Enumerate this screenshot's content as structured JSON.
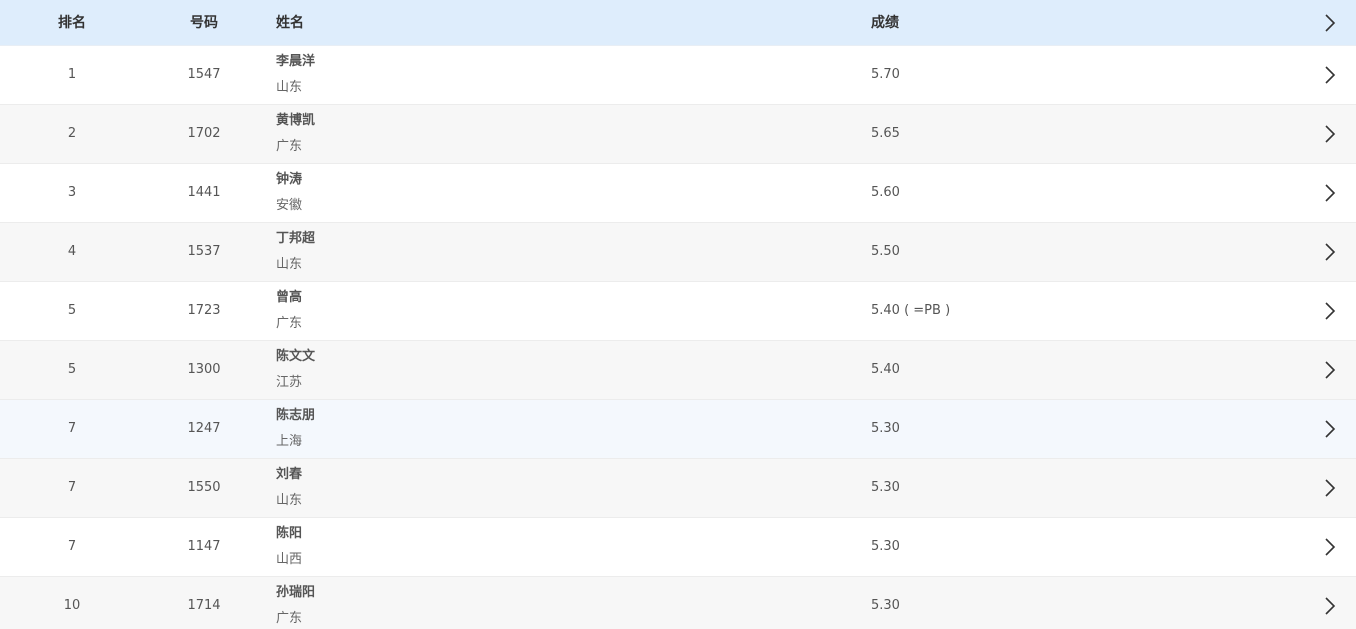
{
  "header": {
    "rank": "排名",
    "number": "号码",
    "name": "姓名",
    "score": "成绩"
  },
  "rows": [
    {
      "rank": "1",
      "number": "1547",
      "name": "李晨洋",
      "region": "山东",
      "score": "5.70"
    },
    {
      "rank": "2",
      "number": "1702",
      "name": "黄博凯",
      "region": "广东",
      "score": "5.65"
    },
    {
      "rank": "3",
      "number": "1441",
      "name": "钟涛",
      "region": "安徽",
      "score": "5.60"
    },
    {
      "rank": "4",
      "number": "1537",
      "name": "丁邦超",
      "region": "山东",
      "score": "5.50"
    },
    {
      "rank": "5",
      "number": "1723",
      "name": "曾高",
      "region": "广东",
      "score": "5.40 ( =PB )"
    },
    {
      "rank": "5",
      "number": "1300",
      "name": "陈文文",
      "region": "江苏",
      "score": "5.40"
    },
    {
      "rank": "7",
      "number": "1247",
      "name": "陈志朋",
      "region": "上海",
      "score": "5.30"
    },
    {
      "rank": "7",
      "number": "1550",
      "name": "刘春",
      "region": "山东",
      "score": "5.30"
    },
    {
      "rank": "7",
      "number": "1147",
      "name": "陈阳",
      "region": "山西",
      "score": "5.30"
    },
    {
      "rank": "10",
      "number": "1714",
      "name": "孙瑞阳",
      "region": "广东",
      "score": "5.30"
    }
  ],
  "icons": {
    "row_arrow": "chevron-right-icon",
    "header_arrow": "chevron-right-icon"
  },
  "colors": {
    "header_bg": "#deedfc",
    "row_alt_bg": "#f7f7f7",
    "row_hover_bg": "#f4f8fd"
  }
}
